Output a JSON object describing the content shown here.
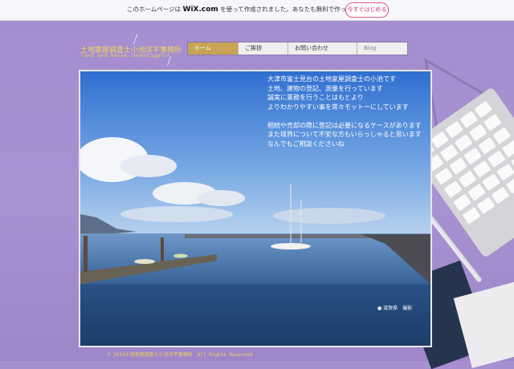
{
  "wix_banner": {
    "text_prefix": "このホームページは",
    "brand": "WiX.com",
    "text_suffix": "を使って作成されました。あなたも無料で作ってみませんか？",
    "cta": "今すぐはじめる"
  },
  "logo": {
    "title": "土地家屋調査士小池洋平事務所",
    "subtitle": "land and house investigator"
  },
  "nav": {
    "items": [
      {
        "label": "ホーム",
        "active": true
      },
      {
        "label": "ご挨拶",
        "active": false
      },
      {
        "label": "お問い合わせ",
        "active": false
      },
      {
        "label": "Blog",
        "active": false
      }
    ]
  },
  "intro": {
    "lines": [
      "大津市富士見台の土地家屋調査士の小池です",
      "土地、建物の登記、測量を行っています",
      "誠実に業務を行うことはもとより",
      "よりわかりやすい事を常々モットーにしています",
      "",
      "相続や売却の際に登記は必要になるケースがあります",
      "また境界について不安な方もいらっしゃると思います",
      "なんでもご相談くださいね"
    ]
  },
  "photo": {
    "credit": "● 滋賀県　撮影"
  },
  "footer": {
    "copyright": "© 2014土地家屋調査士小池洋平事務所　All Rights Reserved"
  },
  "colors": {
    "background": "#a88fd0",
    "logo_text": "#f2d65a",
    "nav_active": "#c8a455",
    "wix_cta": "#d02f7c"
  }
}
